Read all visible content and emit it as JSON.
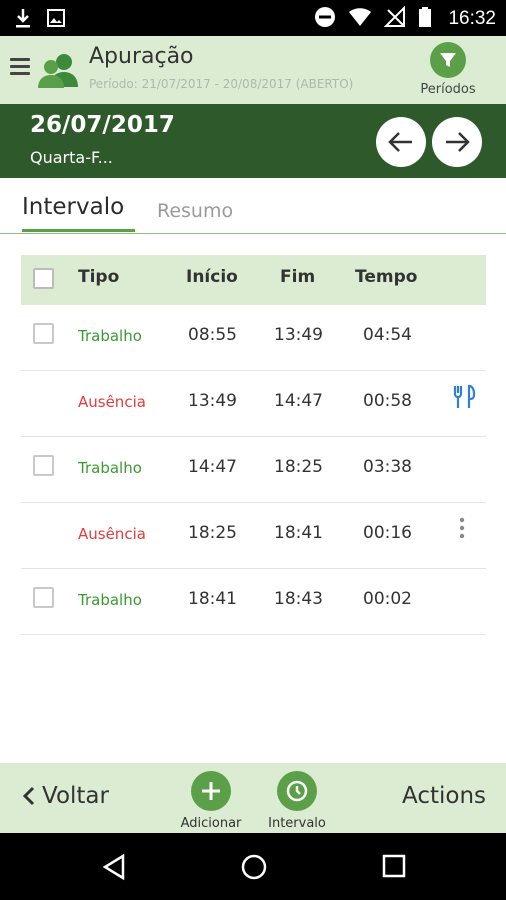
{
  "status_bar": {
    "time": "16:32",
    "icons": [
      "download-icon",
      "image-icon",
      "do-not-disturb-icon",
      "wifi-icon",
      "signal-off-icon",
      "battery-icon"
    ]
  },
  "app_bar": {
    "title": "Apuração",
    "subtitle": "Período: 21/07/2017 - 20/08/2017 (ABERTO)",
    "periodos_label": "Períodos"
  },
  "date_bar": {
    "date": "26/07/2017",
    "weekday": "Quarta-F..."
  },
  "tabs": [
    {
      "label": "Intervalo",
      "active": true
    },
    {
      "label": "Resumo",
      "active": false
    }
  ],
  "table": {
    "headers": {
      "tipo": "Tipo",
      "inicio": "Início",
      "fim": "Fim",
      "tempo": "Tempo"
    },
    "rows": [
      {
        "tipo": "Trabalho",
        "kind": "work",
        "inicio": "08:55",
        "fim": "13:49",
        "tempo": "04:54",
        "checkbox": true,
        "action": ""
      },
      {
        "tipo": "Ausência",
        "kind": "abs",
        "inicio": "13:49",
        "fim": "14:47",
        "tempo": "00:58",
        "checkbox": false,
        "action": "fork-knife-icon"
      },
      {
        "tipo": "Trabalho",
        "kind": "work",
        "inicio": "14:47",
        "fim": "18:25",
        "tempo": "03:38",
        "checkbox": true,
        "action": ""
      },
      {
        "tipo": "Ausência",
        "kind": "abs",
        "inicio": "18:25",
        "fim": "18:41",
        "tempo": "00:16",
        "checkbox": false,
        "action": "more-vert-icon"
      },
      {
        "tipo": "Trabalho",
        "kind": "work",
        "inicio": "18:41",
        "fim": "18:43",
        "tempo": "00:02",
        "checkbox": true,
        "action": ""
      }
    ]
  },
  "bottom_bar": {
    "back_label": "Voltar",
    "add_label": "Adicionar",
    "interval_label": "Intervalo",
    "actions_label": "Actions"
  },
  "colors": {
    "primary_dark": "#2e5a2b",
    "primary_light": "#dcecd3",
    "accent": "#5ba048",
    "work": "#3a9a32",
    "absence": "#e23c3c",
    "icon_blue": "#2f7fd4"
  }
}
